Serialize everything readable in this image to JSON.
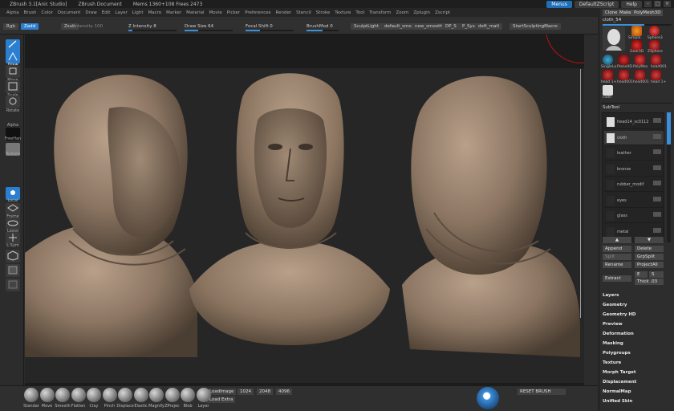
{
  "titlebar": {
    "app": "ZBrush  3.1[Anic Studio]",
    "doc": "ZBrush Document",
    "mem": "Mems 1360+108  Frees 2473",
    "menus_btn": "Menus",
    "default_script": "DefaultZScript",
    "help": "Help"
  },
  "menubar": [
    "Alpha",
    "Brush",
    "Color",
    "Document",
    "Draw",
    "Edit",
    "Layer",
    "Light",
    "Macro",
    "Marker",
    "Material",
    "Movie",
    "Picker",
    "Preferences",
    "Render",
    "Stencil",
    "Stroke",
    "Texture",
    "Tool",
    "Transform",
    "Zoom",
    "Zplugin",
    "Zscript"
  ],
  "options": {
    "rgb": "Rgb",
    "zadd": "Zadd",
    "zsub": "Zsub",
    "zintensity_label": "Z Intensity",
    "zintensity_value": "8",
    "rgb_intensity": "Intensity 100",
    "draw_size_label": "Draw Size",
    "draw_size_value": "64",
    "focal_shift_label": "Focal Shift",
    "focal_shift_value": "0",
    "brushmod_label": "BrushMod",
    "brushmod_value": "0",
    "sculptlight": "SculptLight",
    "preset1": "default_smo",
    "preset2": "new_smooth",
    "preset3": "DP_S",
    "preset4": "P_Sys",
    "preset5": "deft_matl",
    "start_macro": "StartSculptingMacro",
    "intensity_level": 0.08,
    "draw_size_level": 0.28,
    "focal_level": 0.3,
    "brushmod_level": 0.5
  },
  "leftshelf": {
    "edit": "Edit",
    "draw": "Draw",
    "move": "Move",
    "scale": "Scale",
    "rotate": "Rotate",
    "alpha": "Alpha",
    "freehand": "FreeHan",
    "texture": "Texture",
    "local": "Local",
    "frame": "Frame",
    "lasso": "Lasso",
    "lsym": "L.Sym"
  },
  "bottomshelf": {
    "brushes": [
      "Standar",
      "Move",
      "Smooth",
      "Flatten",
      "Clay",
      "Pinch",
      "Displace",
      "Elastic",
      "Magnify",
      "ZProjec",
      "Blob",
      "Layer"
    ],
    "loadimage": "LoadImage",
    "loadextra": "Load Extra",
    "res1": "1024",
    "res2": "2048",
    "res3": "4096",
    "reset": "RESET BRUSH"
  },
  "rightpanel": {
    "clone": "Clone",
    "make": "Make",
    "polymesh": "PolyMesh3D",
    "tool_name": "cloth_54",
    "thumbs": [
      "Simple",
      "Sphere3",
      "Gear3D",
      "ZSphere",
      "SingleLa",
      "PlaneXD",
      "PolyMes",
      "head001",
      "head 1+",
      "head001",
      "head001",
      "head 1+",
      "cloth"
    ],
    "subtool_title": "SubTool",
    "subtools": [
      "head14_sc0112",
      "cloth",
      "leather",
      "bronze",
      "rubber_modif",
      "eyes",
      "glass",
      "metal"
    ],
    "append": "Append",
    "delete": "Delete",
    "split": "Split",
    "grpsplit": "GrpSplit",
    "rename": "Rename",
    "projectall": "ProjectAll",
    "extract": "Extract",
    "e_smt": "E Smt",
    "s_smt": "S Smt",
    "thick_label": "Thick",
    "thick_value": ".03",
    "menus": [
      "Layers",
      "Geometry",
      "Geometry HD",
      "Preview",
      "Deformation",
      "Masking",
      "Polygroups",
      "Texture",
      "Morph Target",
      "Displacement",
      "NormalMap",
      "Unified Skin"
    ]
  },
  "colors": {
    "accent": "#2a7fd0",
    "bg": "#2b2b2b",
    "clay": "#8c7663"
  }
}
